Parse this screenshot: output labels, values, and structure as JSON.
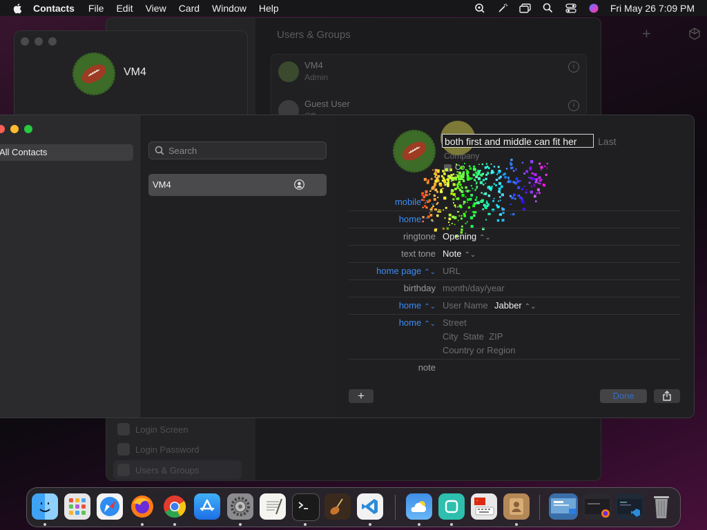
{
  "menubar": {
    "app_name": "Contacts",
    "items": [
      "File",
      "Edit",
      "View",
      "Card",
      "Window",
      "Help"
    ],
    "clock": "Fri May 26  7:09 PM"
  },
  "settings_window": {
    "title": "Users & Groups",
    "users": [
      {
        "name": "VM4",
        "role": "Admin"
      },
      {
        "name": "Guest User",
        "role": "Off"
      }
    ],
    "sidebar_bottom": [
      "Login Screen",
      "Login Password",
      "Users & Groups"
    ]
  },
  "card_window": {
    "name": "VM4"
  },
  "contacts": {
    "sidebar": {
      "group": "All Contacts"
    },
    "search": {
      "placeholder": "Search"
    },
    "list": [
      {
        "name": "VM4"
      }
    ],
    "detail": {
      "first_name_value": "both first and middle can fit her",
      "last_placeholder": "Last",
      "company_placeholder": "Company",
      "company_checkbox_label": "Co",
      "rows": {
        "mobile": {
          "label": "mobile",
          "value": ""
        },
        "home_phone": {
          "label": "home",
          "value": ""
        },
        "ringtone": {
          "label": "ringtone",
          "value": "Opening"
        },
        "text_tone": {
          "label": "text tone",
          "value": "Note"
        },
        "home_page": {
          "label": "home page",
          "placeholder": "URL"
        },
        "birthday": {
          "label": "birthday",
          "placeholder": "month/day/year"
        },
        "im": {
          "label": "home",
          "placeholder": "User Name",
          "service": "Jabber"
        },
        "address": {
          "label": "home",
          "street": "Street",
          "city": "City  State  ZIP",
          "country": "Country or Region"
        },
        "note": {
          "label": "note"
        }
      },
      "add_label": "+",
      "done_label": "Done"
    }
  },
  "colors": {
    "accent_blue": "#3b8cf5",
    "traffic_red": "#fe5f57",
    "traffic_yellow": "#febc2e",
    "traffic_green": "#28c840"
  },
  "dock": {
    "apps": [
      "Finder",
      "Launchpad",
      "Safari",
      "Firefox",
      "Chrome",
      "App Store",
      "System Settings",
      "TextEdit",
      "Terminal",
      "Instruments",
      "Visual Studio Code",
      "Weather",
      "App",
      "Keyboard Input",
      "Contacts",
      "Screenshot",
      "Firefox Window",
      "VS Code Window",
      "Trash"
    ]
  }
}
